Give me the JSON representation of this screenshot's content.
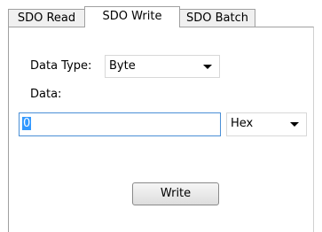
{
  "tabs": [
    {
      "label": "SDO Read"
    },
    {
      "label": "SDO Write"
    },
    {
      "label": "SDO Batch"
    }
  ],
  "form": {
    "data_type_label": "Data Type:",
    "data_type_value": "Byte",
    "data_label": "Data:",
    "data_value": "0",
    "format_value": "Hex",
    "write_button": "Write"
  },
  "icons": {
    "dropdown": "chevron-down-icon"
  }
}
